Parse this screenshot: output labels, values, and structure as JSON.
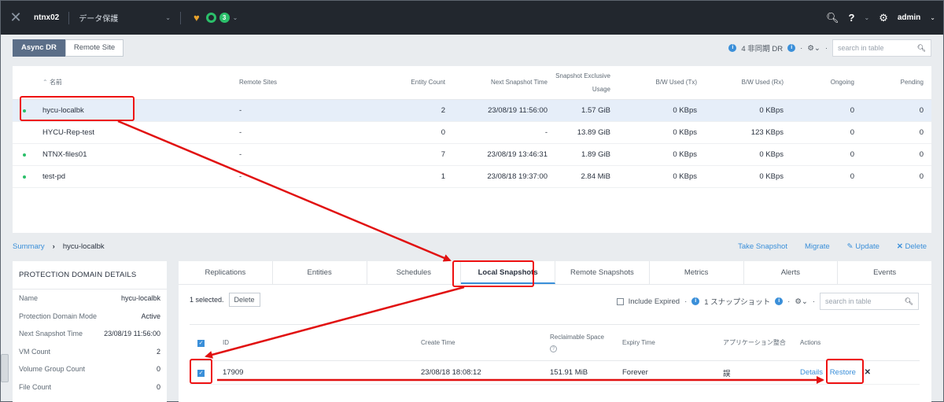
{
  "topbar": {
    "cluster": "ntnx02",
    "section": "データ保護",
    "alert_count": "3",
    "user": "admin"
  },
  "toolbar": {
    "tab_async": "Async DR",
    "tab_remote": "Remote Site",
    "summary_count": "4 非同期 DR",
    "search_placeholder": "search in table"
  },
  "pd_table": {
    "headers": [
      "名前",
      "Remote Sites",
      "Entity Count",
      "Next Snapshot Time",
      "Snapshot Exclusive Usage",
      "B/W Used (Tx)",
      "B/W Used (Rx)",
      "Ongoing",
      "Pending"
    ],
    "rows": [
      {
        "name": "hycu-localbk",
        "remote": "-",
        "entity": "2",
        "next": "23/08/19 11:56:00",
        "usage": "1.57 GiB",
        "tx": "0 KBps",
        "rx": "0 KBps",
        "ongoing": "0",
        "pending": "0"
      },
      {
        "name": "HYCU-Rep-test",
        "remote": "-",
        "entity": "0",
        "next": "-",
        "usage": "13.89 GiB",
        "tx": "0 KBps",
        "rx": "123 KBps",
        "ongoing": "0",
        "pending": "0"
      },
      {
        "name": "NTNX-files01",
        "remote": "-",
        "entity": "7",
        "next": "23/08/19 13:46:31",
        "usage": "1.89 GiB",
        "tx": "0 KBps",
        "rx": "0 KBps",
        "ongoing": "0",
        "pending": "0"
      },
      {
        "name": "test-pd",
        "remote": "-",
        "entity": "1",
        "next": "23/08/18 19:37:00",
        "usage": "2.84 MiB",
        "tx": "0 KBps",
        "rx": "0 KBps",
        "ongoing": "0",
        "pending": "0"
      }
    ]
  },
  "breadcrumb": {
    "root": "Summary",
    "current": "hycu-localbk"
  },
  "actions": {
    "take": "Take Snapshot",
    "migrate": "Migrate",
    "update": "Update",
    "delete": "Delete"
  },
  "details": {
    "title": "PROTECTION DOMAIN DETAILS",
    "rows": [
      {
        "k": "Name",
        "v": "hycu-localbk"
      },
      {
        "k": "Protection Domain Mode",
        "v": "Active"
      },
      {
        "k": "Next Snapshot Time",
        "v": "23/08/19 11:56:00"
      },
      {
        "k": "VM Count",
        "v": "2"
      },
      {
        "k": "Volume Group Count",
        "v": "0"
      },
      {
        "k": "File Count",
        "v": "0"
      }
    ]
  },
  "tabs": [
    "Replications",
    "Entities",
    "Schedules",
    "Local Snapshots",
    "Remote Snapshots",
    "Metrics",
    "Alerts",
    "Events"
  ],
  "snap": {
    "selected": "1 selected.",
    "delete": "Delete",
    "include_expired": "Include Expired",
    "count": "1 スナップショット",
    "search_placeholder": "search in table",
    "headers": {
      "id": "ID",
      "create": "Create Time",
      "reclaim": "Reclaimable Space",
      "expiry": "Expiry Time",
      "app": "アプリケーション整合",
      "actions": "Actions"
    },
    "row": {
      "id": "17909",
      "create": "23/08/18 18:08:12",
      "reclaim": "151.91 MiB",
      "expiry": "Forever",
      "app": "誤",
      "details": "Details",
      "restore": "Restore"
    }
  },
  "colors": {
    "accent": "#3a8fd9",
    "annotation": "#e11111",
    "topbar": "#22272e"
  }
}
